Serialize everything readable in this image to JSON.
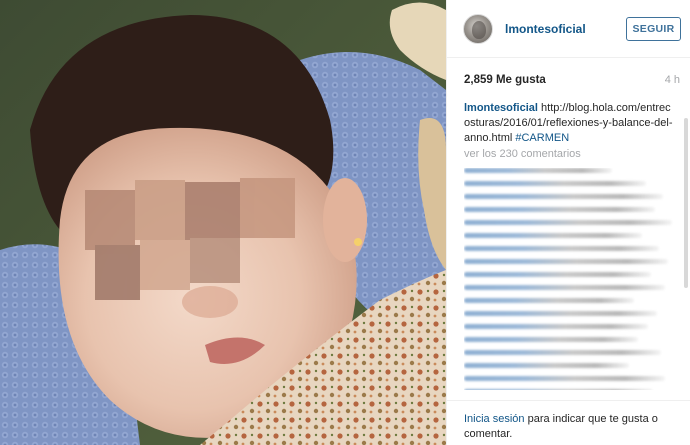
{
  "post": {
    "username": "lmontesoficial",
    "follow_label": "SEGUIR",
    "likes": "2,859 Me gusta",
    "time_ago": "4 h",
    "caption": {
      "user": "lmontesoficial",
      "text": " http://blog.hola.com/entrecosturas/2016/01/reflexiones-y-balance-del-anno.html ",
      "hashtag": "#CARMEN"
    },
    "view_comments": "ver los 230 comentarios",
    "comments": [
      {
        "fill": 0.7
      },
      {
        "fill": 0.86
      },
      {
        "fill": 0.94
      },
      {
        "fill": 0.9
      },
      {
        "fill": 0.98
      },
      {
        "fill": 0.84
      },
      {
        "fill": 0.92
      },
      {
        "fill": 0.96
      },
      {
        "fill": 0.88
      },
      {
        "fill": 0.95
      },
      {
        "fill": 0.8
      },
      {
        "fill": 0.91
      },
      {
        "fill": 0.87
      },
      {
        "fill": 0.82
      },
      {
        "fill": 0.93
      },
      {
        "fill": 0.78
      },
      {
        "fill": 0.95
      },
      {
        "fill": 0.89
      }
    ],
    "footer": {
      "login_link": "Inicia sesión",
      "login_text": " para indicar que te gusta o comentar."
    }
  },
  "colors": {
    "link_blue": "#125688",
    "button_blue": "#3f729b",
    "muted_gray": "#a5a7aa"
  },
  "icons": {
    "avatar": "profile-photo"
  }
}
